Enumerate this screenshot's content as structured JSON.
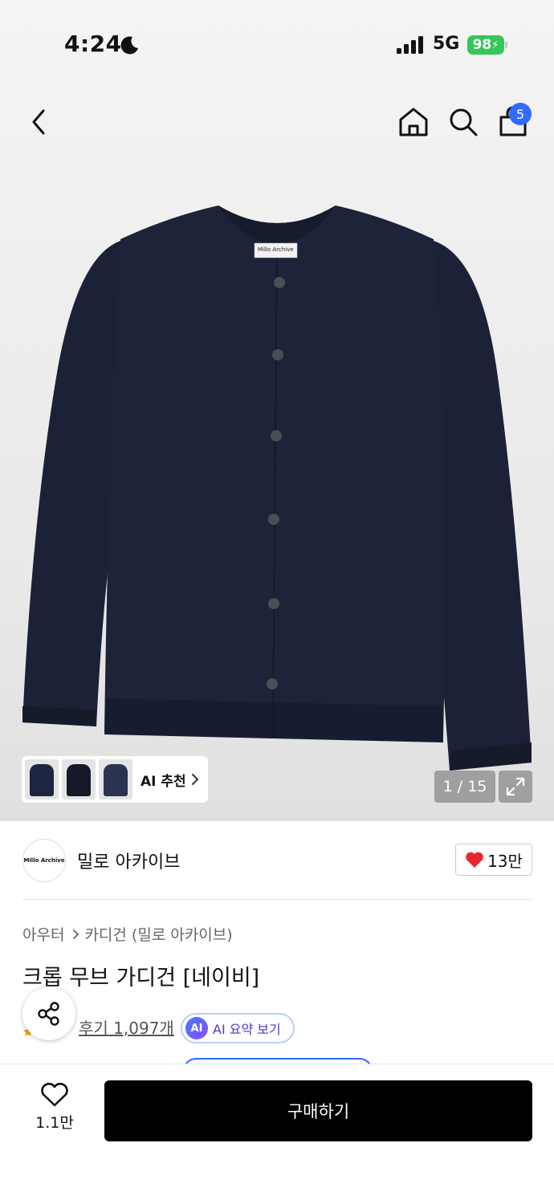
{
  "status_bar": {
    "time": "4:24",
    "network": "5G",
    "battery": "98"
  },
  "nav": {
    "cart_count": "5",
    "icons": [
      "chevron-left-icon",
      "home-icon",
      "search-icon",
      "shopping-bag-icon"
    ]
  },
  "gallery": {
    "image_label_text": "Millo Archive",
    "ai_recommend_label": "AI 추천",
    "page_counter": "1 / 15"
  },
  "brand": {
    "logo_text": "Millo Archive",
    "name": "밀로 아카이브",
    "likes": "13만"
  },
  "product": {
    "breadcrumb": [
      "아우터",
      "카디건 (밀로 아카이브)"
    ],
    "title": "크롭 무브 가디건 [네이비]",
    "reviews": "후기 1,097개",
    "ai_summary_badge": "AI",
    "ai_summary_label": "AI 요약 보기"
  },
  "bottom_bar": {
    "wish_count": "1.1만",
    "buy_label": "구매하기"
  },
  "colors": {
    "cardigan_navy": "#1b2237",
    "accent_blue": "#2f6bff",
    "heart_red": "#e8262f",
    "battery_green": "#34c759"
  }
}
